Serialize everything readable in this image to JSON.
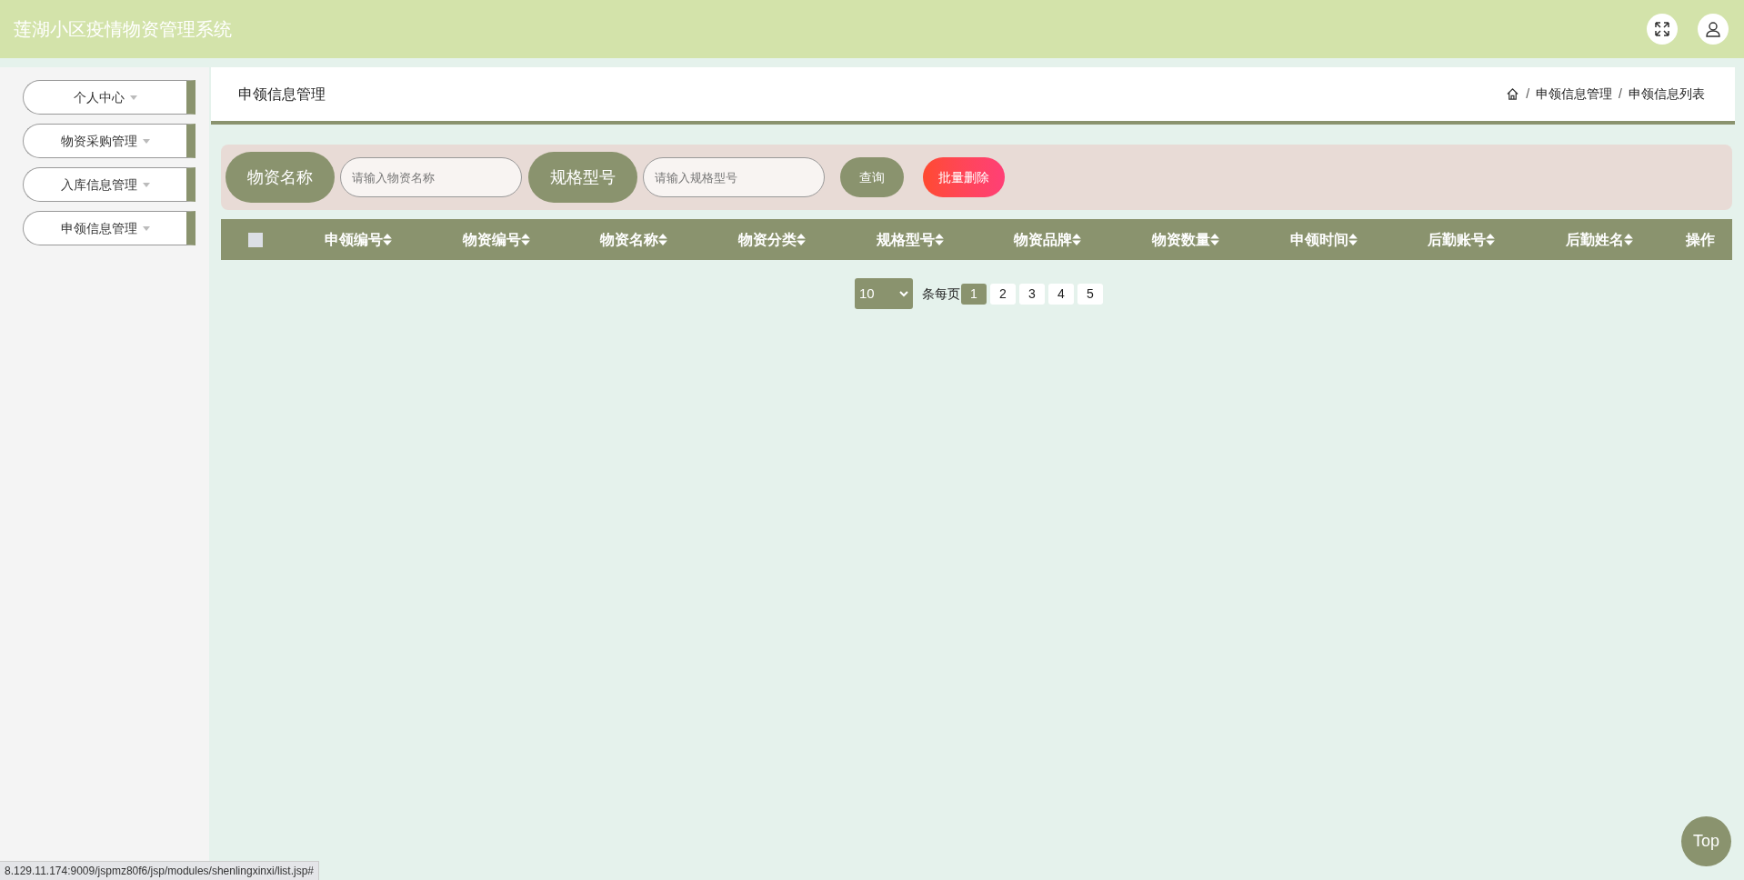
{
  "header": {
    "title": "莲湖小区疫情物资管理系统"
  },
  "sidebar": {
    "items": [
      {
        "label": "个人中心"
      },
      {
        "label": "物资采购管理"
      },
      {
        "label": "入库信息管理"
      },
      {
        "label": "申领信息管理"
      }
    ]
  },
  "page_title": "申领信息管理",
  "breadcrumb": [
    {
      "kind": "separator",
      "text": "/"
    },
    {
      "kind": "link",
      "text": "申领信息管理"
    },
    {
      "kind": "separator",
      "text": "/"
    },
    {
      "kind": "link",
      "text": "申领信息列表"
    }
  ],
  "search": {
    "fields": [
      {
        "label": "物资名称",
        "placeholder": "请输入物资名称"
      },
      {
        "label": "规格型号",
        "placeholder": "请输入规格型号"
      }
    ],
    "query_button": "查询",
    "delete_button": "批量删除"
  },
  "table": {
    "select_all": {
      "checked": false
    },
    "columns": [
      {
        "label": "申领编号",
        "sortable": true
      },
      {
        "label": "物资编号",
        "sortable": true
      },
      {
        "label": "物资名称",
        "sortable": true
      },
      {
        "label": "物资分类",
        "sortable": true
      },
      {
        "label": "规格型号",
        "sortable": true
      },
      {
        "label": "物资品牌",
        "sortable": true
      },
      {
        "label": "物资数量",
        "sortable": true
      },
      {
        "label": "申领时间",
        "sortable": true
      },
      {
        "label": "后勤账号",
        "sortable": true
      },
      {
        "label": "后勤姓名",
        "sortable": true
      },
      {
        "label": "操作",
        "sortable": false
      }
    ]
  },
  "pagination": {
    "page_size": "10",
    "per_page_label": "条每页",
    "pages": [
      {
        "label": "1",
        "selected": true
      },
      {
        "label": "2",
        "selected": false
      },
      {
        "label": "3",
        "selected": false
      },
      {
        "label": "4",
        "selected": false
      },
      {
        "label": "5",
        "selected": false
      }
    ]
  },
  "top_button": "Top",
  "status_bar": "8.129.11.174:9009/jspmz80f6/jsp/modules/shenlingxinxi/list.jsp#"
}
